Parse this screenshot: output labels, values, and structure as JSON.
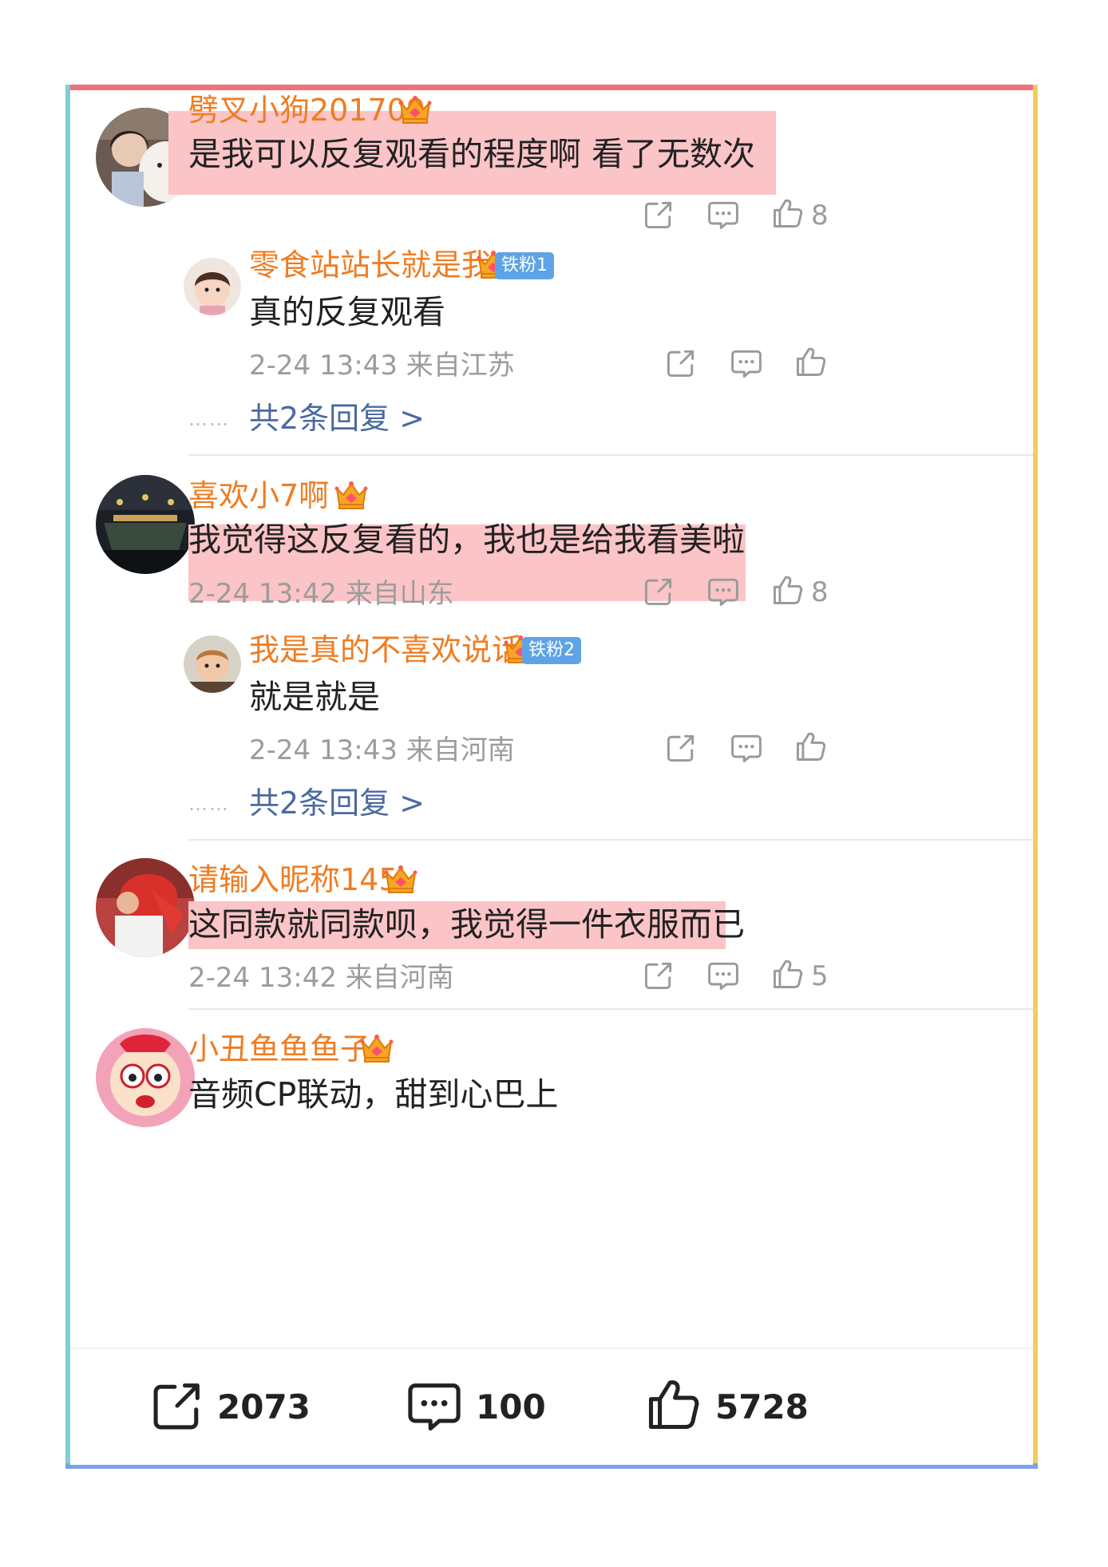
{
  "comments": [
    {
      "username": "劈叉小狗201709",
      "text": "是我可以反复观看的程度啊 看了无数次",
      "likes": "8",
      "reply": {
        "username": "零食站站长就是我",
        "badge": "铁粉1",
        "text": "真的反复观看",
        "meta": "2-24 13:43 来自江苏"
      },
      "reply_count": "共2条回复 >"
    },
    {
      "username": "喜欢小7啊",
      "text": "我觉得这反复看的，我也是给我看美啦",
      "meta": "2-24 13:42 来自山东",
      "likes": "8",
      "reply": {
        "username": "我是真的不喜欢说话",
        "badge": "铁粉2",
        "text": "就是就是",
        "meta": "2-24 13:43 来自河南"
      },
      "reply_count": "共2条回复 >"
    },
    {
      "username": "请输入昵称145",
      "text": "这同款就同款呗，我觉得一件衣服而已",
      "meta": "2-24 13:42 来自河南",
      "likes": "5"
    },
    {
      "username": "小丑鱼鱼鱼子",
      "text": "音频CP联动，甜到心巴上"
    }
  ],
  "reply_dots": "……",
  "bottom_bar": {
    "share_count": "2073",
    "comment_count": "100",
    "like_count": "5728"
  },
  "colors": {
    "username": "#ef7c22",
    "highlight": "#fbc4c7",
    "reply_link": "#4a6aa0",
    "border_top": "#f0717a",
    "border_left": "#7fcfd6",
    "border_right": "#f3cd58",
    "border_bottom": "#7fa0e8"
  },
  "icons": [
    "share-icon",
    "comment-icon",
    "like-icon",
    "crown-icon"
  ]
}
